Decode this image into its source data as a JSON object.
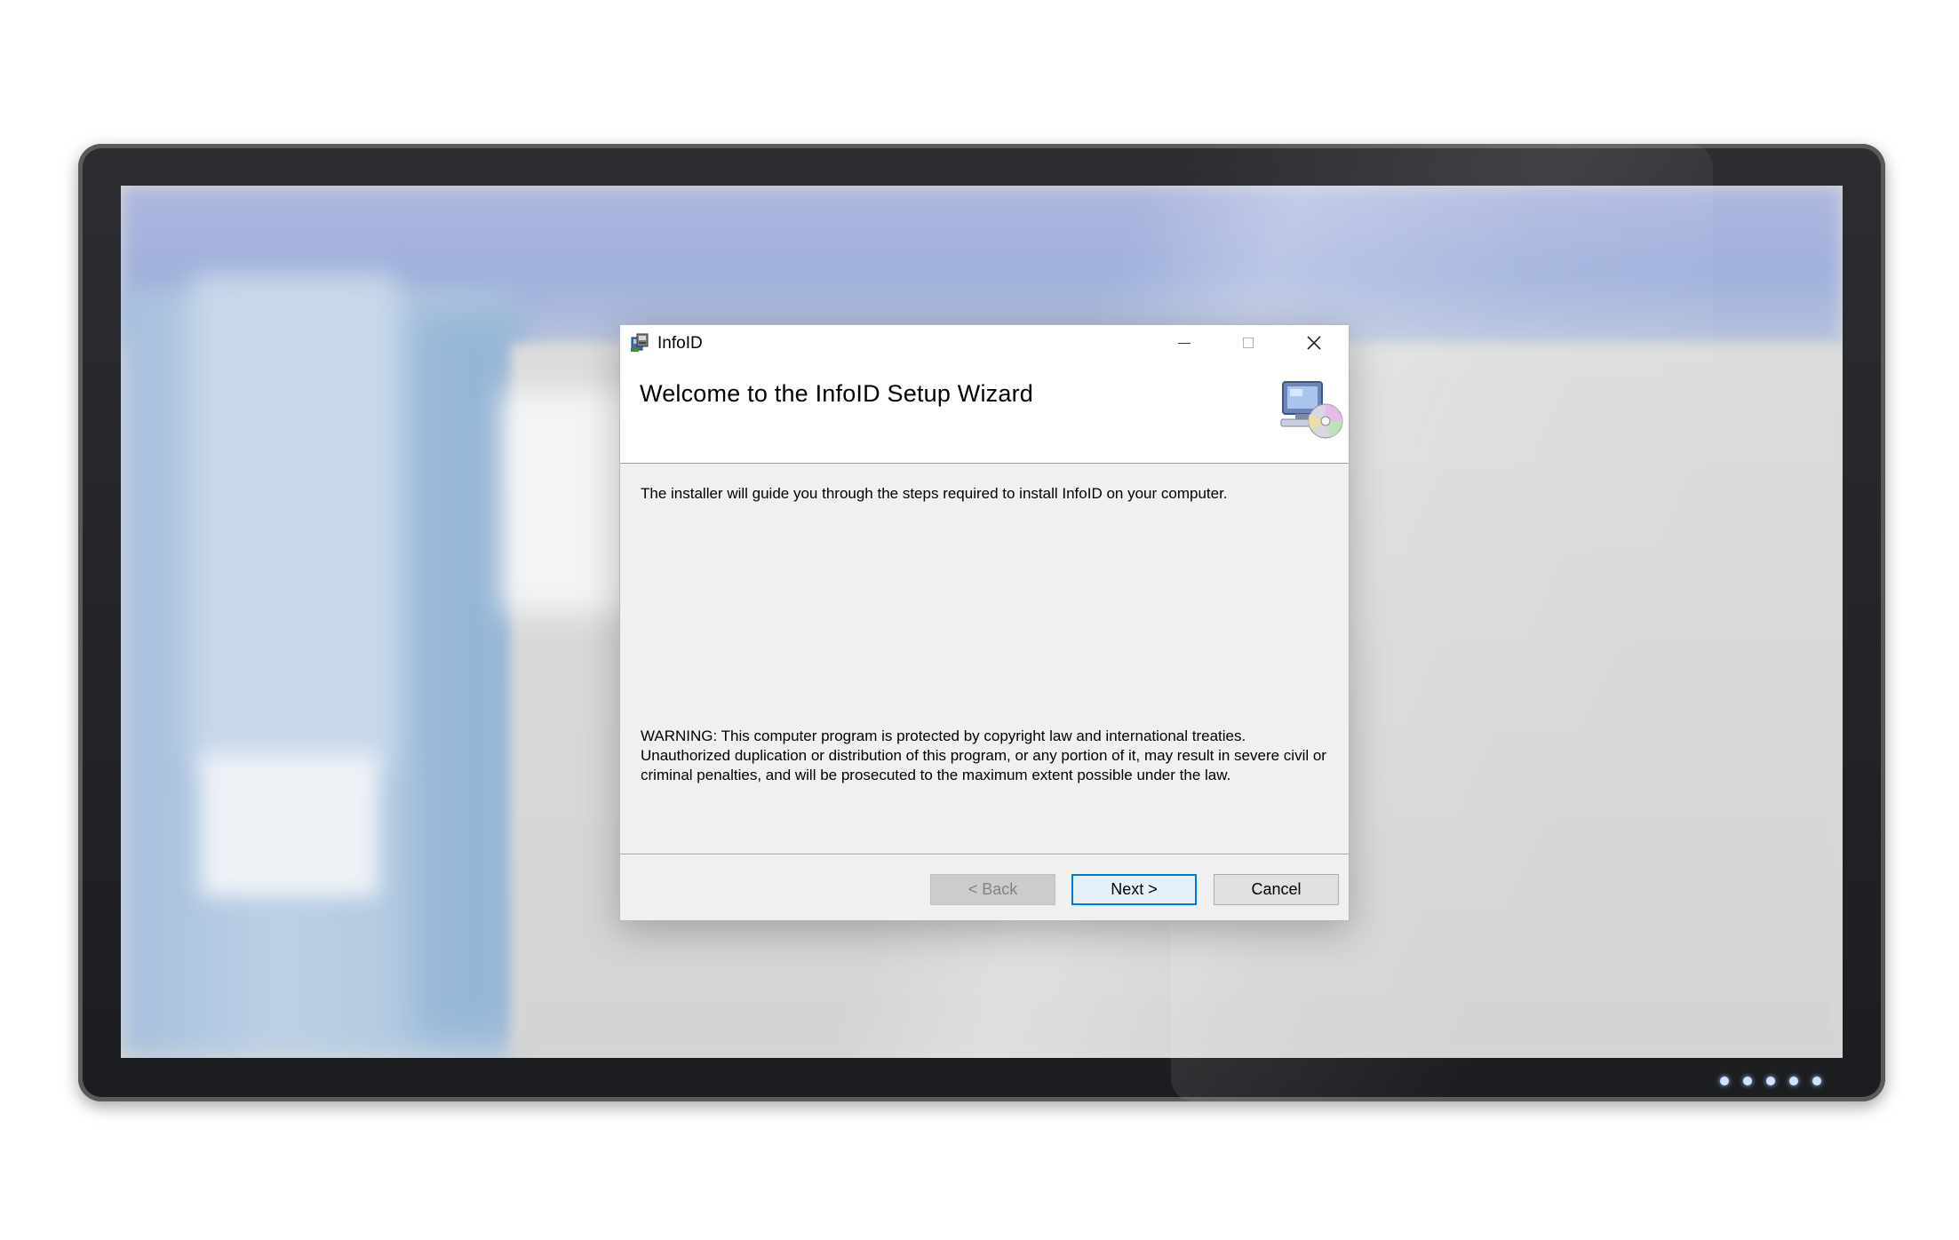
{
  "window": {
    "title": "InfoID",
    "minimize_icon": "minimize-icon",
    "maximize_icon": "maximize-icon",
    "close_icon": "close-icon"
  },
  "header": {
    "title": "Welcome to the InfoID Setup Wizard",
    "icon": "computer-cd-icon"
  },
  "body": {
    "intro": "The installer will guide you through the steps required to install InfoID on your computer.",
    "warning": "WARNING: This computer program is protected by copyright law and international treaties. Unauthorized duplication or distribution of this program, or any portion of it, may result in severe civil or criminal penalties, and will be prosecuted to the maximum extent possible under the law."
  },
  "buttons": {
    "back": "< Back",
    "next": "Next >",
    "cancel": "Cancel"
  },
  "colors": {
    "focus_border": "#0078d7",
    "dialog_bg": "#f0f0f0",
    "header_bg": "#ffffff"
  }
}
